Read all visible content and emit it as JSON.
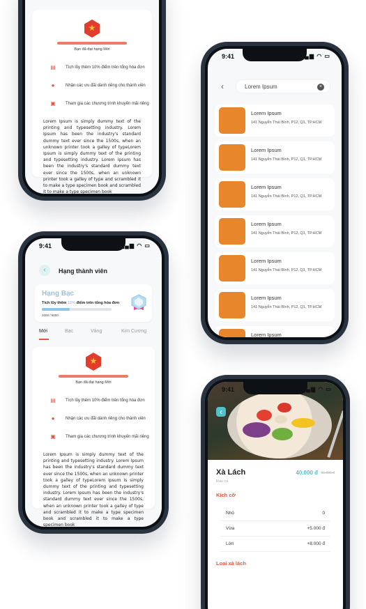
{
  "benefits": {
    "reached_text": "Bạn đã đạt hạng Mới",
    "items": [
      "Tích lũy thêm 10% điểm trên tổng hóa đơn",
      "Nhận các ưu đãi dành riêng cho thành viên",
      "Tham gia các chương trình khuyến mãi riêng"
    ],
    "description": "Lorem Ipsum is simply dummy text of the printing and typesetting industry. Lorem Ipsum has been the industry's standard dummy text ever since the 1500s, when an unknown printer took a galley of typeLorem Ipsum is simply dummy text of the printing and typesetting industry. Lorem Ipsum has been the industry's standard dummy text ever since the 1500s, when an unknown printer took a galley of type and scrambled it to make a type specimen book and scrambled it to make a type specimen book"
  },
  "search_screen": {
    "time": "9:41",
    "status_icons": "▂▄▆ ◠ ▭",
    "query": "Lorem Ipsum",
    "results": [
      {
        "name": "Lorem Ipsum",
        "address": "141 Nguyễn Thái Bình, P12, Q1, TP.HCM"
      },
      {
        "name": "Lorem Ipsum",
        "address": "141 Nguyễn Thái Bình, P12, Q1, TP.HCM"
      },
      {
        "name": "Lorem Ipsum",
        "address": "141 Nguyễn Thái Bình, P12, Q1, TP.HCM"
      },
      {
        "name": "Lorem Ipsum",
        "address": "141 Nguyễn Thái Bình, P12, Q1, TP.HCM"
      },
      {
        "name": "Lorem Ipsum",
        "address": "141 Nguyễn Thái Bình, P12, Q1, TP.HCM"
      },
      {
        "name": "Lorem Ipsum",
        "address": "141 Nguyễn Thái Bình, P12, Q1, TP.HCM"
      },
      {
        "name": "Lorem Ipsum",
        "address": ""
      }
    ]
  },
  "membership_screen": {
    "time": "9:41",
    "status_icons": "▂▄▆ ◠ ▭",
    "title": "Hạng thành viên",
    "tier_name": "Hạng Bạc",
    "accumulate_prefix": "Tích lũy thêm",
    "accumulate_pct": "15%",
    "accumulate_suffix": "điểm trên tổng hóa đơn",
    "points_text": "2000 / 5000",
    "progress": 0.4,
    "tabs": [
      "Mới",
      "Bạc",
      "Vàng",
      "Kim Cương"
    ],
    "active_tab": "Mới"
  },
  "product_screen": {
    "time": "9:41",
    "status_icons": "▂▄▆ ◠ ▭",
    "product_name": "Xà Lách",
    "product_sub": "Rau củ",
    "price": "40.000 đ",
    "old_price": "60.000 đ",
    "size_section": "Kích cỡ",
    "sizes": [
      {
        "label": "Nhỏ",
        "price": "0"
      },
      {
        "label": "Vừa",
        "price": "+5.000 đ"
      },
      {
        "label": "Lớn",
        "price": "+8.000 đ"
      }
    ],
    "type_section": "Loại xà lách"
  },
  "colors": {
    "accent_red": "#e5553f",
    "accent_teal": "#4fc3c7",
    "thumb_orange": "#e8862b"
  }
}
